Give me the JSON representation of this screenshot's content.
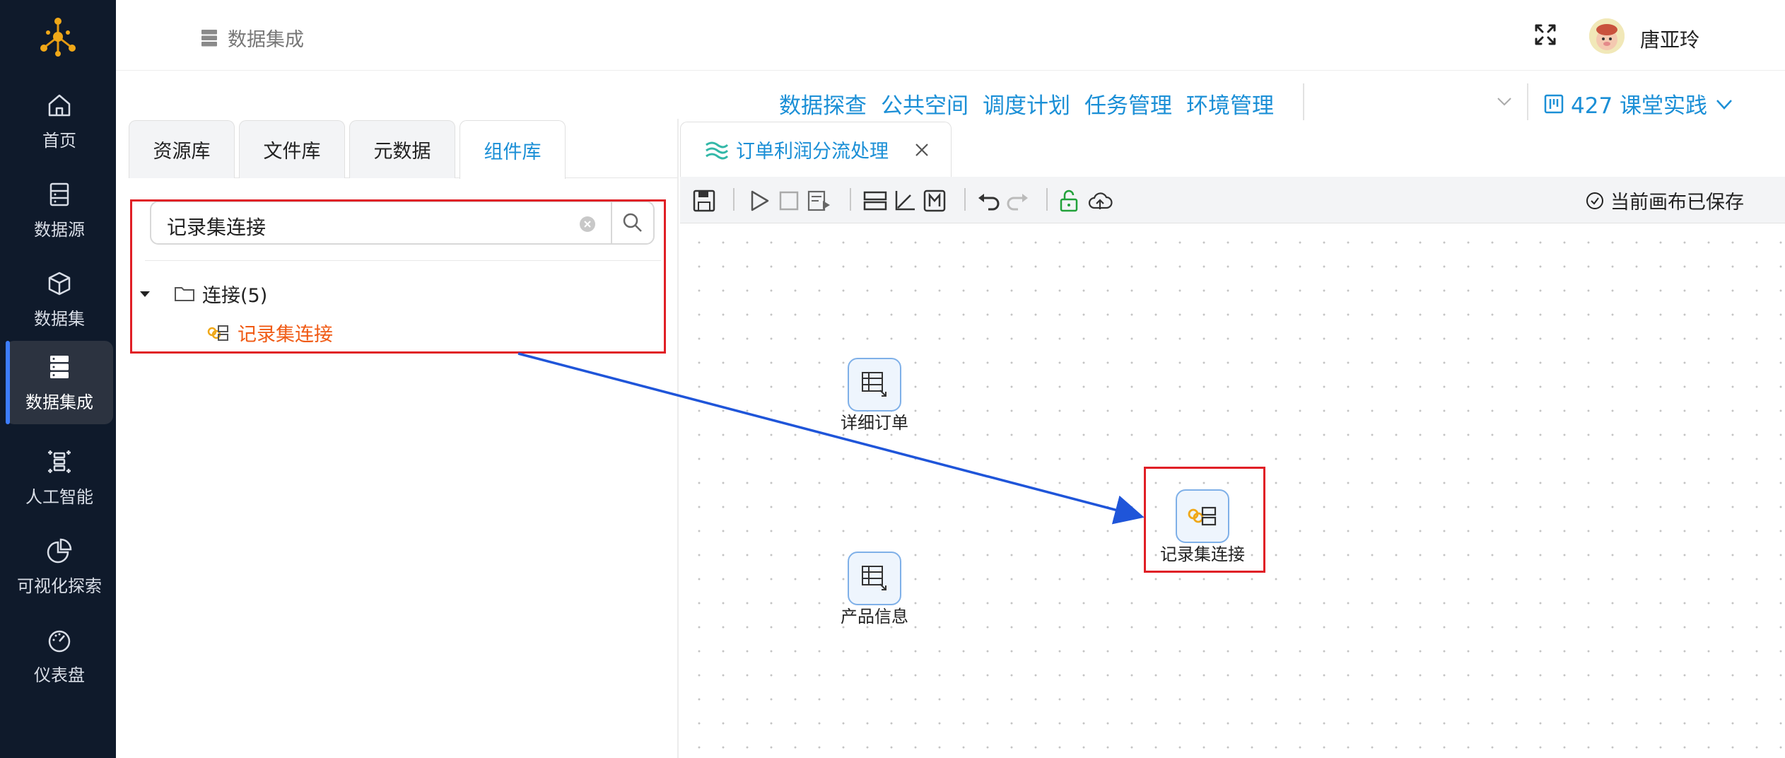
{
  "sidebar": {
    "items": [
      {
        "label": "首页",
        "icon": "home-icon"
      },
      {
        "label": "数据源",
        "icon": "database-icon"
      },
      {
        "label": "数据集",
        "icon": "cube-icon"
      },
      {
        "label": "数据集成",
        "icon": "server-icon",
        "active": true
      },
      {
        "label": "人工智能",
        "icon": "ai-icon"
      },
      {
        "label": "可视化探索",
        "icon": "pie-chart-icon"
      },
      {
        "label": "仪表盘",
        "icon": "gauge-icon"
      }
    ]
  },
  "header": {
    "title": "数据集成",
    "username": "唐亚玲"
  },
  "subnav": {
    "links": [
      "数据探查",
      "公共空间",
      "调度计划",
      "任务管理",
      "环境管理"
    ],
    "project": "427 课堂实践"
  },
  "left_panel": {
    "tabs": [
      "资源库",
      "文件库",
      "元数据",
      "组件库"
    ],
    "active_tab": "组件库",
    "search": {
      "value": "记录集连接"
    },
    "tree": {
      "folder": "连接(5)",
      "item": "记录集连接"
    }
  },
  "canvas": {
    "tab_title": "订单利润分流处理",
    "status": "当前画布已保存",
    "nodes": [
      {
        "label": "详细订单",
        "icon": "table-icon"
      },
      {
        "label": "产品信息",
        "icon": "table-icon"
      },
      {
        "label": "记录集连接",
        "icon": "record-join-icon"
      }
    ]
  },
  "colors": {
    "sidebar_bg": "#0f1a2b",
    "accent": "#1b8fd6",
    "highlight_red": "#e01f26",
    "tree_item": "#f05a14",
    "arrow": "#1f55d9"
  }
}
